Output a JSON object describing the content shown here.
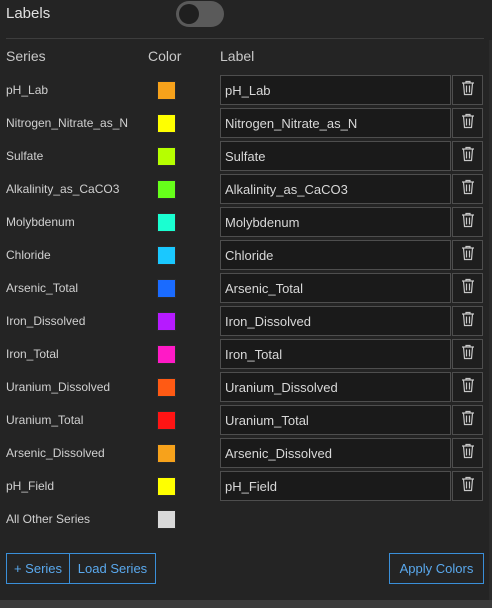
{
  "section": {
    "title": "Labels",
    "toggle_state": "off"
  },
  "headers": {
    "series": "Series",
    "color": "Color",
    "label": "Label"
  },
  "rows": [
    {
      "series": "pH_Lab",
      "color": "#f7a21b",
      "label": "pH_Lab"
    },
    {
      "series": "Nitrogen_Nitrate_as_N",
      "color": "#ffff00",
      "label": "Nitrogen_Nitrate_as_N"
    },
    {
      "series": "Sulfate",
      "color": "#b6ff00",
      "label": "Sulfate"
    },
    {
      "series": "Alkalinity_as_CaCO3",
      "color": "#66ff1a",
      "label": "Alkalinity_as_CaCO3"
    },
    {
      "series": "Molybdenum",
      "color": "#1affd1",
      "label": "Molybdenum"
    },
    {
      "series": "Chloride",
      "color": "#1ac8ff",
      "label": "Chloride"
    },
    {
      "series": "Arsenic_Total",
      "color": "#1a6bff",
      "label": "Arsenic_Total"
    },
    {
      "series": "Iron_Dissolved",
      "color": "#b61aff",
      "label": "Iron_Dissolved"
    },
    {
      "series": "Iron_Total",
      "color": "#ff1ac6",
      "label": "Iron_Total"
    },
    {
      "series": "Uranium_Dissolved",
      "color": "#ff5a14",
      "label": "Uranium_Dissolved"
    },
    {
      "series": "Uranium_Total",
      "color": "#ff1414",
      "label": "Uranium_Total"
    },
    {
      "series": "Arsenic_Dissolved",
      "color": "#f7a21b",
      "label": "Arsenic_Dissolved"
    },
    {
      "series": "pH_Field",
      "color": "#ffff00",
      "label": "pH_Field"
    },
    {
      "series": "All Other Series",
      "color": "#d9d9d9"
    }
  ],
  "buttons": {
    "add_series": "+ Series",
    "load_series": "Load Series",
    "apply_colors": "Apply Colors"
  },
  "icons": {
    "delete": "trash-icon"
  },
  "accent": "#3a8fd9"
}
